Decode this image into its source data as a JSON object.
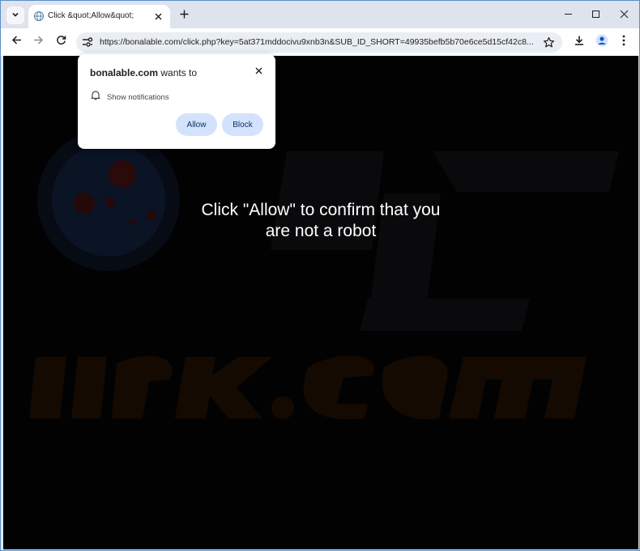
{
  "browser": {
    "tab": {
      "title": "Click &quot;Allow&quot;"
    },
    "url": "https://bonalable.com/click.php?key=5at371mddocivu9xnb3n&SUB_ID_SHORT=49935befb5b70e6ce5d15cf42c8..."
  },
  "popup": {
    "site": "bonalable.com",
    "wants_to": " wants to",
    "permission": "Show notifications",
    "allow_label": "Allow",
    "block_label": "Block"
  },
  "page": {
    "message": "Click \"Allow\" to confirm that you are not a robot"
  },
  "watermark": {
    "text": "risk.com"
  },
  "colors": {
    "accent": "#d3e3fd",
    "frame": "#5b8fc7",
    "page_bg": "#020202"
  }
}
